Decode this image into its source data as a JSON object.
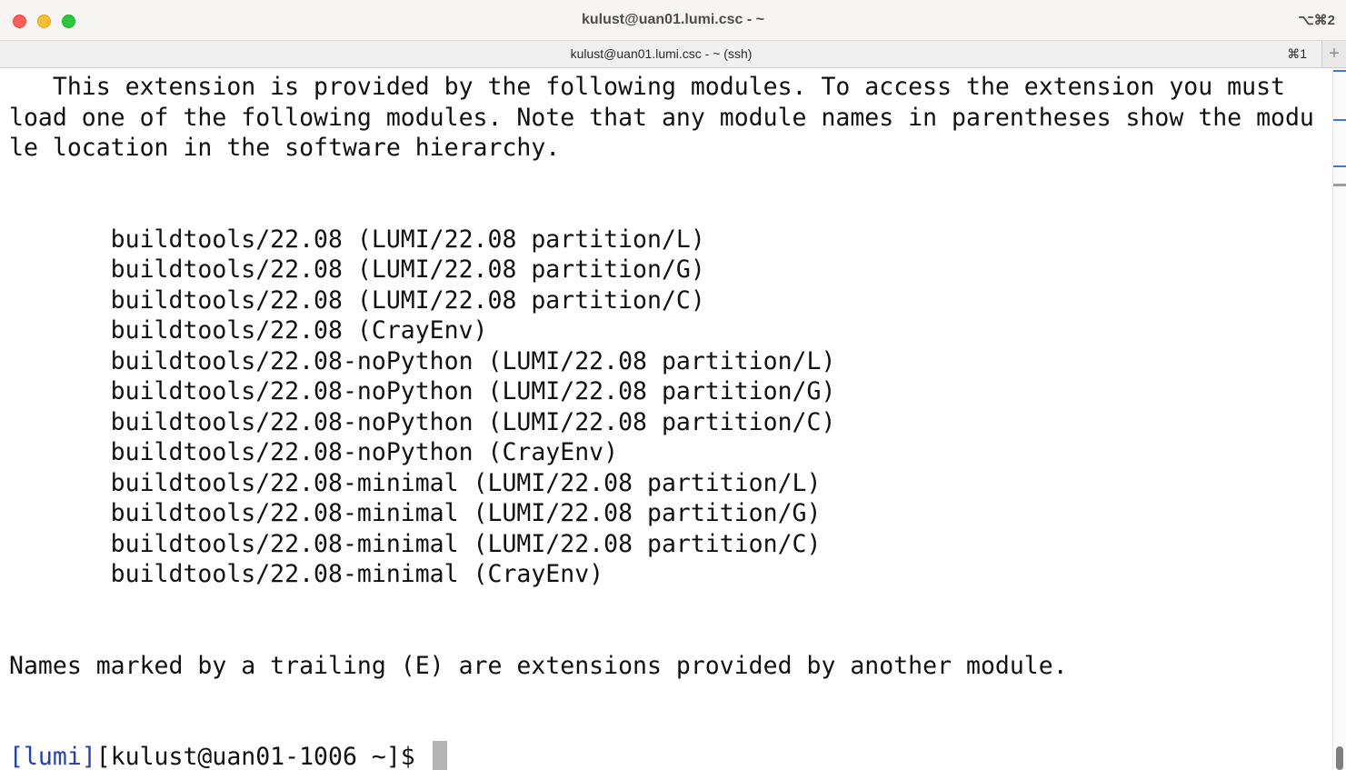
{
  "window": {
    "title": "kulust@uan01.lumi.csc - ~",
    "shortcut": "⌥⌘2"
  },
  "tab": {
    "title": "kulust@uan01.lumi.csc - ~ (ssh)",
    "shortcut": "⌘1",
    "new_tab_label": "+"
  },
  "terminal": {
    "lines": [
      "   This extension is provided by the following modules. To access the extension you must",
      "load one of the following modules. Note that any module names in parentheses show the modu",
      "le location in the software hierarchy.",
      "",
      "",
      "       buildtools/22.08 (LUMI/22.08 partition/L)",
      "       buildtools/22.08 (LUMI/22.08 partition/G)",
      "       buildtools/22.08 (LUMI/22.08 partition/C)",
      "       buildtools/22.08 (CrayEnv)",
      "       buildtools/22.08-noPython (LUMI/22.08 partition/L)",
      "       buildtools/22.08-noPython (LUMI/22.08 partition/G)",
      "       buildtools/22.08-noPython (LUMI/22.08 partition/C)",
      "       buildtools/22.08-noPython (CrayEnv)",
      "       buildtools/22.08-minimal (LUMI/22.08 partition/L)",
      "       buildtools/22.08-minimal (LUMI/22.08 partition/G)",
      "       buildtools/22.08-minimal (LUMI/22.08 partition/C)",
      "       buildtools/22.08-minimal (CrayEnv)",
      "",
      "",
      "Names marked by a trailing (E) are extensions provided by another module.",
      "",
      ""
    ],
    "prompt_tag": "[lumi]",
    "prompt_rest": "[kulust@uan01-1006 ~]$ "
  },
  "colors": {
    "prompt_tag": "#1f3fbf",
    "text": "#111111",
    "scroll_mark": "#3a78e8"
  }
}
